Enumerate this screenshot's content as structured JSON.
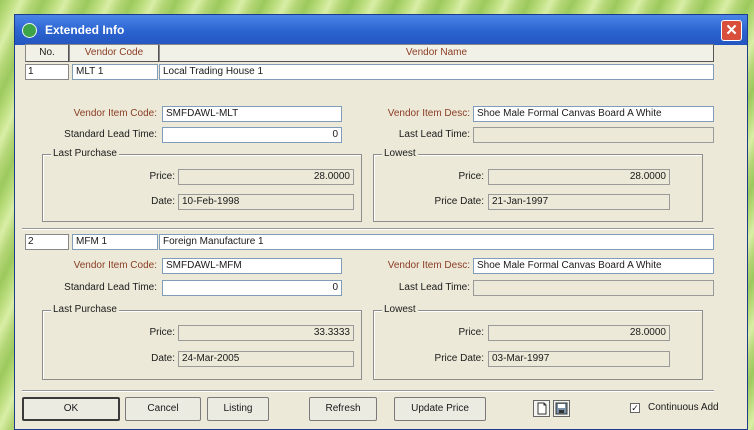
{
  "window": {
    "title": "Extended Info",
    "close_glyph": "✕"
  },
  "columns": {
    "no": "No.",
    "vendor_code": "Vendor Code",
    "vendor_name": "Vendor Name"
  },
  "vendors": [
    {
      "no": "1",
      "code": "MLT 1",
      "name": "Local Trading House 1",
      "item_code_label": "Vendor Item Code:",
      "item_code": "SMFDAWL-MLT",
      "item_desc_label": "Vendor Item Desc:",
      "item_desc": "Shoe Male Formal Canvas Board A White",
      "std_lead_label": "Standard Lead Time:",
      "std_lead": "0",
      "last_lead_label": "Last Lead Time:",
      "last_lead": "",
      "last_purchase": {
        "label": "Last Purchase",
        "price_label": "Price:",
        "price": "28.0000",
        "date_label": "Date:",
        "date": "10-Feb-1998"
      },
      "lowest": {
        "label": "Lowest",
        "price_label": "Price:",
        "price": "28.0000",
        "date_label": "Price Date:",
        "date": "21-Jan-1997"
      }
    },
    {
      "no": "2",
      "code": "MFM 1",
      "name": "Foreign Manufacture 1",
      "item_code_label": "Vendor Item Code:",
      "item_code": "SMFDAWL-MFM",
      "item_desc_label": "Vendor Item Desc:",
      "item_desc": "Shoe Male Formal Canvas Board A White",
      "std_lead_label": "Standard Lead Time:",
      "std_lead": "0",
      "last_lead_label": "Last Lead Time:",
      "last_lead": "",
      "last_purchase": {
        "label": "Last Purchase",
        "price_label": "Price:",
        "price": "33.3333",
        "date_label": "Date:",
        "date": "24-Mar-2005"
      },
      "lowest": {
        "label": "Lowest",
        "price_label": "Price:",
        "price": "28.0000",
        "date_label": "Price Date:",
        "date": "03-Mar-1997"
      }
    }
  ],
  "buttons": {
    "ok": "OK",
    "cancel": "Cancel",
    "listing": "Listing",
    "refresh": "Refresh",
    "update_price": "Update Price"
  },
  "continuous_add": {
    "label": "Continuous Add",
    "checked": "✓"
  },
  "icons": {
    "app": "app-icon",
    "new_document": "new-document-icon",
    "save": "save-icon"
  }
}
